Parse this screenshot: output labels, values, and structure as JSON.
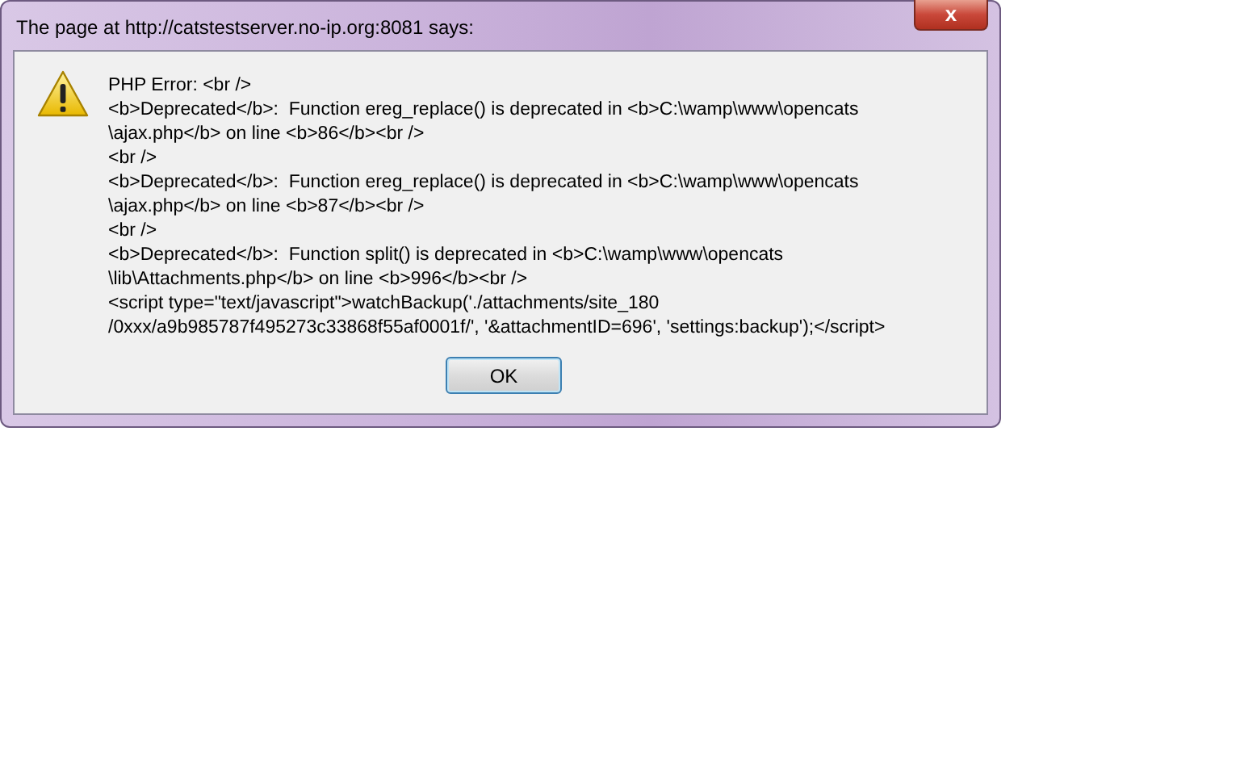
{
  "window": {
    "title": "The page at http://catstestserver.no-ip.org:8081 says:",
    "close": "x"
  },
  "message_lines": [
    "PHP Error: <br />",
    "<b>Deprecated</b>:  Function ereg_replace() is deprecated in <b>C:\\wamp\\www\\opencats",
    "\\ajax.php</b> on line <b>86</b><br />",
    "<br />",
    "<b>Deprecated</b>:  Function ereg_replace() is deprecated in <b>C:\\wamp\\www\\opencats",
    "\\ajax.php</b> on line <b>87</b><br />",
    "<br />",
    "<b>Deprecated</b>:  Function split() is deprecated in <b>C:\\wamp\\www\\opencats",
    "\\lib\\Attachments.php</b> on line <b>996</b><br />",
    "<script type=\"text/javascript\">watchBackup('./attachments/site_180",
    "/0xxx/a9b985787f495273c33868f55af0001f/', '&attachmentID=696', 'settings:backup');</script>"
  ],
  "buttons": [
    "OK"
  ]
}
